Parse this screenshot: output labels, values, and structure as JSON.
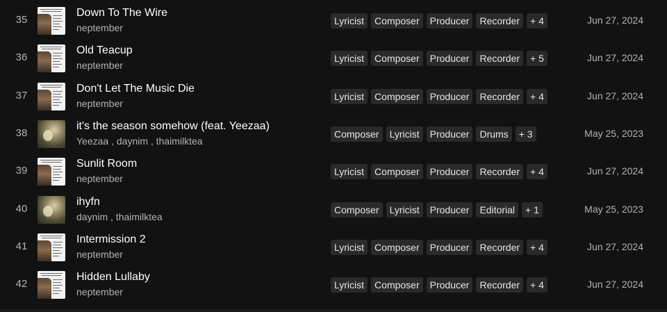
{
  "tracks": [
    {
      "number": "35",
      "title": "Down To The Wire",
      "artists": "neptember",
      "cover": "paper",
      "roles": [
        "Lyricist",
        "Composer",
        "Producer",
        "Recorder",
        "+ 4"
      ],
      "date": "Jun 27, 2024"
    },
    {
      "number": "36",
      "title": "Old Teacup",
      "artists": "neptember",
      "cover": "paper",
      "roles": [
        "Lyricist",
        "Composer",
        "Producer",
        "Recorder",
        "+ 5"
      ],
      "date": "Jun 27, 2024"
    },
    {
      "number": "37",
      "title": "Don't Let The Music Die",
      "artists": "neptember",
      "cover": "paper",
      "roles": [
        "Lyricist",
        "Composer",
        "Producer",
        "Recorder",
        "+ 4"
      ],
      "date": "Jun 27, 2024"
    },
    {
      "number": "38",
      "title": "it's the season somehow (feat. Yeezaa)",
      "artists": "Yeezaa , daynim , thaimilktea",
      "cover": "photo",
      "roles": [
        "Composer",
        "Lyricist",
        "Producer",
        "Drums",
        "+ 3"
      ],
      "date": "May 25, 2023"
    },
    {
      "number": "39",
      "title": "Sunlit Room",
      "artists": "neptember",
      "cover": "paper",
      "roles": [
        "Lyricist",
        "Composer",
        "Producer",
        "Recorder",
        "+ 4"
      ],
      "date": "Jun 27, 2024"
    },
    {
      "number": "40",
      "title": "ihyfn",
      "artists": "daynim , thaimilktea",
      "cover": "photo",
      "roles": [
        "Composer",
        "Lyricist",
        "Producer",
        "Editorial",
        "+ 1"
      ],
      "date": "May 25, 2023"
    },
    {
      "number": "41",
      "title": "Intermission 2",
      "artists": "neptember",
      "cover": "paper",
      "roles": [
        "Lyricist",
        "Composer",
        "Producer",
        "Recorder",
        "+ 4"
      ],
      "date": "Jun 27, 2024"
    },
    {
      "number": "42",
      "title": "Hidden Lullaby",
      "artists": "neptember",
      "cover": "paper",
      "roles": [
        "Lyricist",
        "Composer",
        "Producer",
        "Recorder",
        "+ 4"
      ],
      "date": "Jun 27, 2024"
    }
  ],
  "colors": {
    "background": "#121212",
    "chip": "#2a2a2a",
    "secondary_text": "#b3b3b3"
  }
}
